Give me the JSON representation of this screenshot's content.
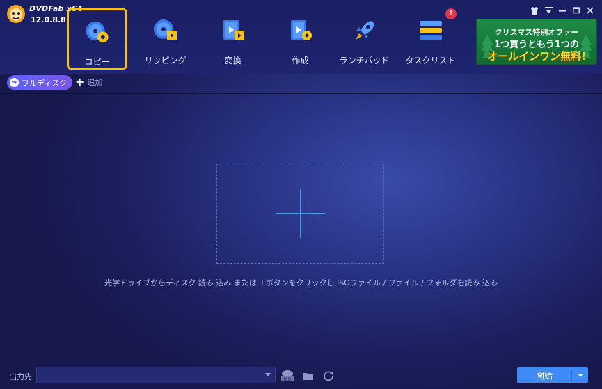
{
  "app": {
    "brand": "DVDFab x64",
    "version": "12.0.8.8"
  },
  "nav": [
    {
      "label": "コピー",
      "active": true
    },
    {
      "label": "リッピング",
      "active": false
    },
    {
      "label": "変換",
      "active": false
    },
    {
      "label": "作成",
      "active": false
    },
    {
      "label": "ランチパッド",
      "active": false
    },
    {
      "label": "タスクリスト",
      "active": false
    }
  ],
  "tasklist_badge": "!",
  "promo": {
    "line1": "クリスマス特別オファー",
    "line2": "1つ買うともう1つの",
    "line3": "オールインワン無料!"
  },
  "toolbar": {
    "full_disc": "フルディスク",
    "add": "追加"
  },
  "dropzone": {
    "hint": "光学ドライブからディスク 読み 込み または +ボタンをクリックし ISOファイル / ファイル / フォルダを読み 込み"
  },
  "footer": {
    "output_label": "出力先:",
    "output_value": "",
    "start": "開始"
  },
  "colors": {
    "accent": "#3d8bf6",
    "active_border": "#f6c20f",
    "badge": "#e8344a",
    "promo_text": "#ffd428"
  }
}
